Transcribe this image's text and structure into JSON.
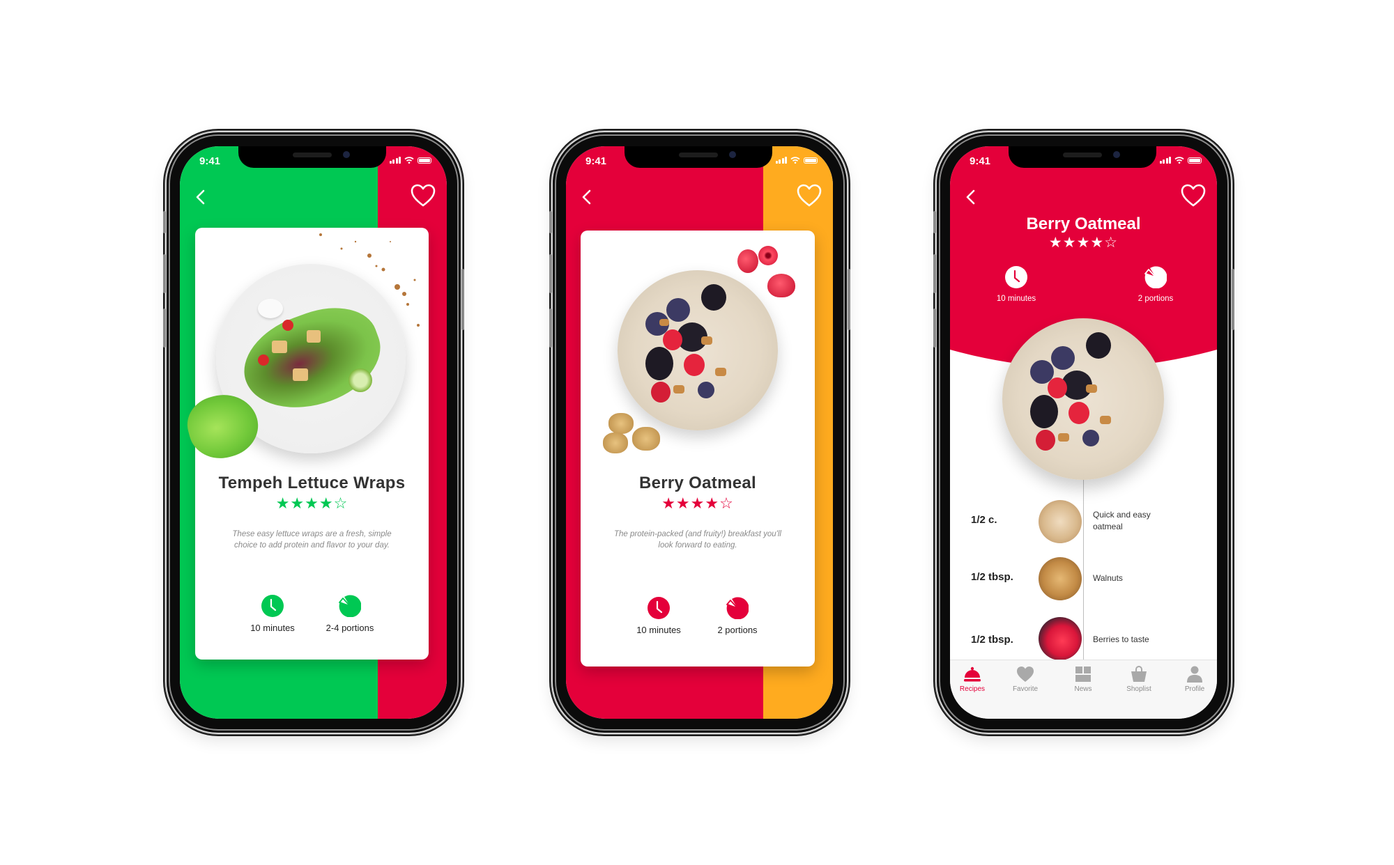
{
  "colors": {
    "green": "#00c853",
    "red": "#e4003a",
    "orange": "#ffab1f",
    "title_dark": "#333333",
    "muted": "#8a8a8a",
    "nav_inactive": "#a9a9a9"
  },
  "status_bar": {
    "time": "9:41"
  },
  "screens": [
    {
      "name": "Tempeh Lettuce Wraps detail card",
      "back_icon": "chevron-left-icon",
      "favorite_icon": "heart-outline-icon",
      "card": {
        "title": "Tempeh Lettuce Wraps",
        "rating": {
          "value": 4,
          "max": 5,
          "display": "★★★★☆"
        },
        "description": "These easy lettuce wraps are a fresh, simple choice to add protein and flavor to your day.",
        "time_icon": "clock-icon",
        "time_label": "10 minutes",
        "portions_icon": "pie-portion-icon",
        "portions_label": "2-4 portions",
        "image": "lettuce-wraps-plate"
      }
    },
    {
      "name": "Berry Oatmeal detail card",
      "back_icon": "chevron-left-icon",
      "favorite_icon": "heart-outline-icon",
      "card": {
        "title": "Berry Oatmeal",
        "rating": {
          "value": 4,
          "max": 5,
          "display": "★★★★☆"
        },
        "description": "The protein-packed (and fruity!) breakfast you'll look forward to eating.",
        "time_icon": "clock-icon",
        "time_label": "10 minutes",
        "portions_icon": "pie-portion-icon",
        "portions_label": "2 portions",
        "image": "berry-oatmeal-bowl"
      }
    },
    {
      "name": "Berry Oatmeal recipe",
      "back_icon": "chevron-left-icon",
      "favorite_icon": "heart-outline-icon",
      "title": "Berry Oatmeal",
      "rating": {
        "value": 4,
        "max": 5,
        "display": "★★★★☆"
      },
      "time_label": "10 minutes",
      "portions_label": "2 portions",
      "image": "berry-oatmeal-bowl",
      "ingredients": [
        {
          "qty": "1/2 c.",
          "name": "Quick and easy oatmeal",
          "image": "rolled-oats"
        },
        {
          "qty": "1/2 tbsp.",
          "name": "Walnuts",
          "image": "walnuts"
        },
        {
          "qty": "1/2 tbsp.",
          "name": "Berries to taste",
          "image": "mixed-berries"
        }
      ],
      "tabbar": [
        {
          "label": "Recipes",
          "icon": "cloche-icon",
          "active": true
        },
        {
          "label": "Favorite",
          "icon": "heart-icon",
          "active": false
        },
        {
          "label": "News",
          "icon": "grid-icon",
          "active": false
        },
        {
          "label": "Shoplist",
          "icon": "shopping-bag-icon",
          "active": false
        },
        {
          "label": "Profile",
          "icon": "user-icon",
          "active": false
        }
      ]
    }
  ]
}
